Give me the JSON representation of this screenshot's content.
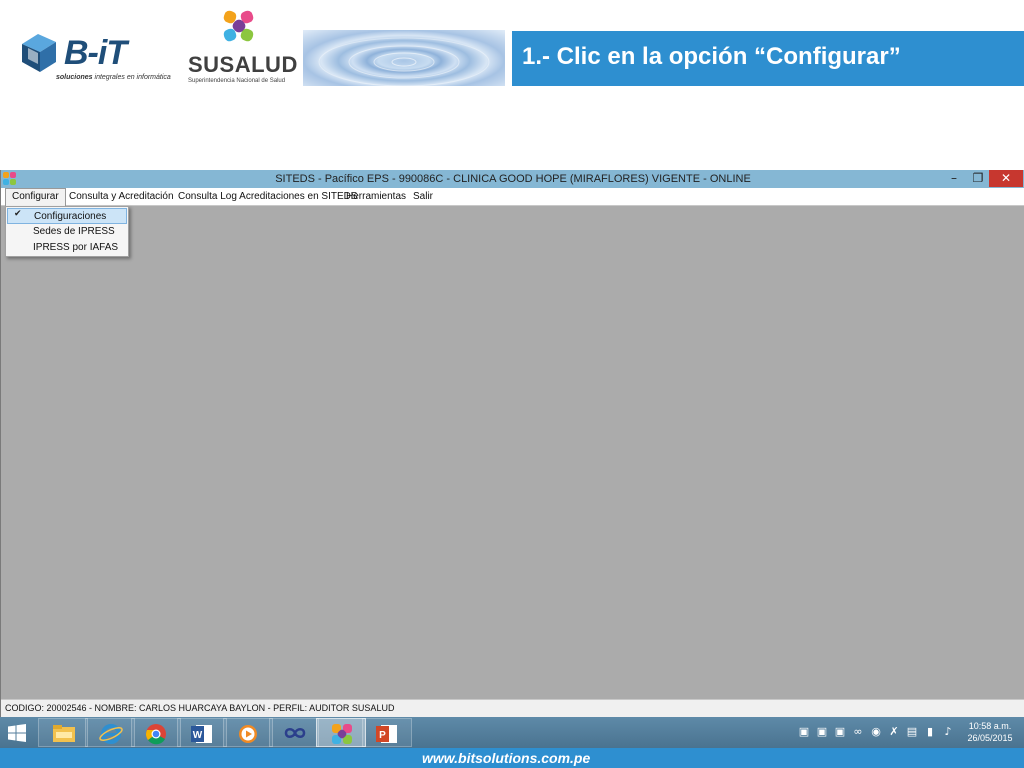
{
  "header": {
    "bit_logo": {
      "name": "B-iT",
      "tagline_bold": "soluciones",
      "tagline_rest": " integrales en informática"
    },
    "susalud_logo": {
      "name": "SUSALUD",
      "tagline": "Superintendencia Nacional de Salud"
    },
    "slide_title": "1.- Clic en la opción “Configurar”"
  },
  "window": {
    "title": "SITEDS - Pacífico EPS - 990086C - CLINICA GOOD HOPE (MIRAFLORES) VIGENTE - ONLINE",
    "controls": {
      "minimize": "–",
      "restore": "❐",
      "close": "✕"
    }
  },
  "menubar": {
    "items": [
      "Configurar",
      "Consulta y Acreditación",
      "Consulta Log Acreditaciones en SITEDS",
      "Herramientas",
      "Salir"
    ]
  },
  "dropdown": {
    "items": [
      {
        "label": "Configuraciones",
        "checked": true
      },
      {
        "label": "Sedes de IPRESS",
        "checked": false
      },
      {
        "label": "IPRESS por IAFAS",
        "checked": false
      }
    ],
    "check_glyph": "✔"
  },
  "statusbar": {
    "text": "CODIGO: 20002546 - NOMBRE: CARLOS HUARCAYA BAYLON - PERFIL: AUDITOR SUSALUD"
  },
  "taskbar": {
    "apps": [
      "file-explorer-icon",
      "internet-explorer-icon",
      "chrome-icon",
      "word-icon",
      "media-player-icon",
      "infinity-app-icon",
      "siteds-app-icon",
      "powerpoint-icon"
    ],
    "active_app": "siteds-app-icon",
    "clock_time": "10:58 a.m.",
    "clock_date": "26/05/2015"
  },
  "footer": {
    "url": "www.bitsolutions.com.pe"
  },
  "colors": {
    "accent_blue": "#2e8fd0",
    "window_titlebar": "#85b7d4",
    "workspace_gray": "#ababab",
    "close_red": "#c7372f",
    "menu_highlight": "#cce4f7"
  }
}
